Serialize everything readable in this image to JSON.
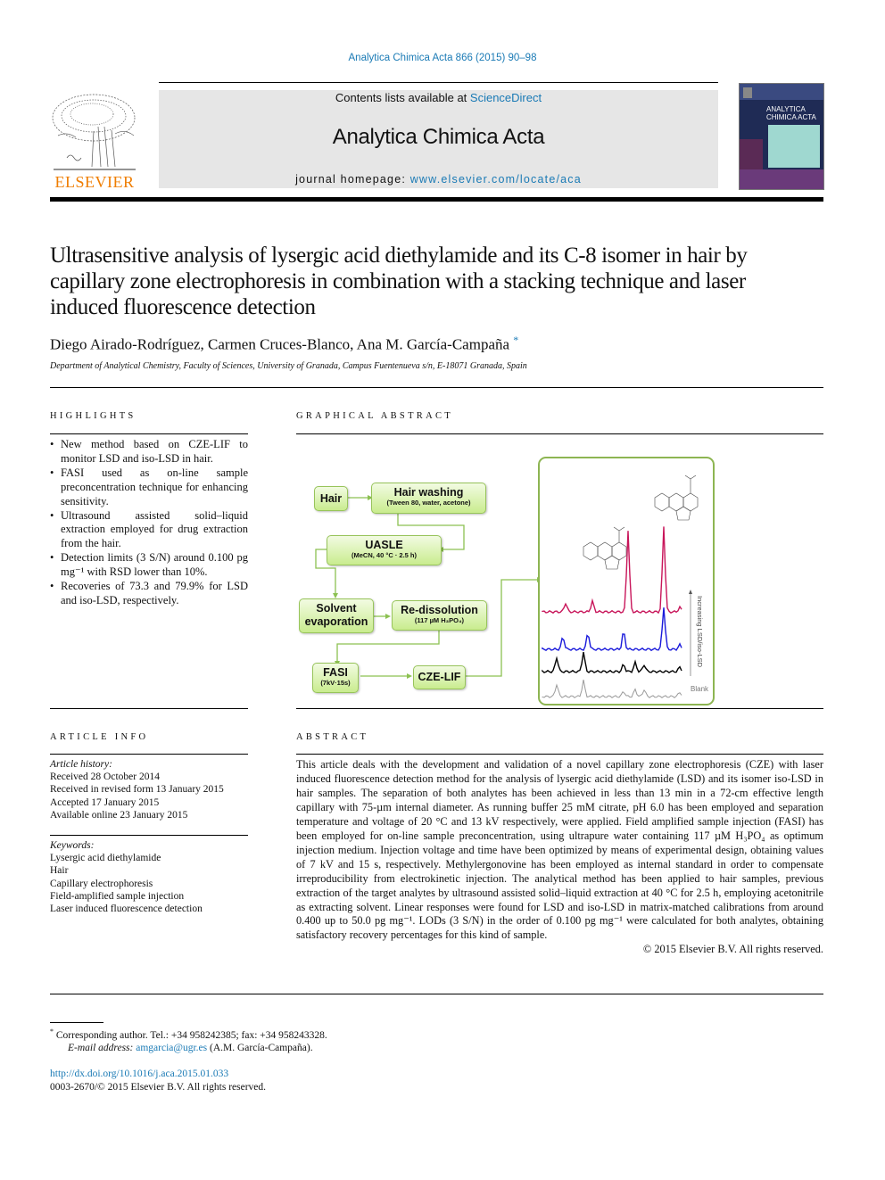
{
  "header": {
    "citation": "Analytica Chimica Acta 866 (2015) 90–98",
    "publisher_logo_text": "ELSEVIER",
    "contents_prefix": "Contents lists available at ",
    "contents_link": "ScienceDirect",
    "journal_title": "Analytica Chimica Acta",
    "homepage_prefix": "journal homepage: ",
    "homepage_link": "www.elsevier.com/locate/aca",
    "cover_title_line1": "ANALYTICA",
    "cover_title_line2": "CHIMICA ACTA"
  },
  "article": {
    "title": "Ultrasensitive analysis of lysergic acid diethylamide and its C-8 isomer in hair by capillary zone electrophoresis in combination with a stacking technique and laser induced fluorescence detection",
    "authors": "Diego Airado-Rodríguez, Carmen Cruces-Blanco, Ana M. García-Campaña",
    "corresponding_mark": "*",
    "affiliation": "Department of Analytical Chemistry, Faculty of Sciences, University of Granada, Campus Fuentenueva s/n, E-18071 Granada, Spain"
  },
  "highlights": {
    "heading": "HIGHLIGHTS",
    "items": [
      "New method based on CZE-LIF to monitor LSD and iso-LSD in hair.",
      "FASI used as on-line sample preconcentration technique for enhancing sensitivity.",
      "Ultrasound assisted solid–liquid extraction employed for drug extraction from the hair.",
      "Detection limits (3 S/N) around 0.100 pg mg⁻¹ with RSD lower than 10%.",
      "Recoveries of 73.3 and 79.9% for LSD and iso-LSD, respectively."
    ]
  },
  "graphical_abstract": {
    "heading": "GRAPHICAL ABSTRACT",
    "flow": {
      "hair": "Hair",
      "washing": "Hair washing",
      "washing_sub": "(Tween 80, water, acetone)",
      "uasle": "UASLE",
      "uasle_sub": "(MeCN, 40 °C · 2.5 h)",
      "solvent1": "Solvent",
      "solvent2": "evaporation",
      "redissolution": "Re-dissolution",
      "redissolution_sub": "(117 µM H₃PO₄)",
      "fasi": "FASI",
      "fasi_sub": "(7kV·15s)",
      "czelif": "CZE-LIF"
    },
    "electropherogram": {
      "axis_label": "Increasing LSD/iso-LSD",
      "blank_label": "Blank",
      "trace_colors": [
        "#c8155a",
        "#1a1adb",
        "#000000",
        "#9a9a9a"
      ]
    }
  },
  "article_info": {
    "heading": "ARTICLE INFO",
    "history_label": "Article history:",
    "history": [
      "Received 28 October 2014",
      "Received in revised form 13 January 2015",
      "Accepted 17 January 2015",
      "Available online 23 January 2015"
    ],
    "keywords_label": "Keywords:",
    "keywords": [
      "Lysergic acid diethylamide",
      "Hair",
      "Capillary electrophoresis",
      "Field-amplified sample injection",
      "Laser induced fluorescence detection"
    ]
  },
  "abstract": {
    "heading": "ABSTRACT",
    "text": "This article deals with the development and validation of a novel capillary zone electrophoresis (CZE) with laser induced fluorescence detection method for the analysis of lysergic acid diethylamide (LSD) and its isomer iso-LSD in hair samples. The separation of both analytes has been achieved in less than 13 min in a 72-cm effective length capillary with 75-µm internal diameter. As running buffer 25 mM citrate, pH 6.0 has been employed and separation temperature and voltage of 20 °C and 13 kV respectively, were applied. Field amplified sample injection (FASI) has been employed for on-line sample preconcentration, using ultrapure water containing 117 µM H₃PO₄ as optimum injection medium. Injection voltage and time have been optimized by means of experimental design, obtaining values of 7 kV and 15 s, respectively. Methylergonovine has been employed as internal standard in order to compensate irreproducibility from electrokinetic injection. The analytical method has been applied to hair samples, previous extraction of the target analytes by ultrasound assisted solid–liquid extraction at 40 °C for 2.5 h, employing acetonitrile as extracting solvent. Linear responses were found for LSD and iso-LSD in matrix-matched calibrations from around 0.400 up to 50.0 pg mg⁻¹. LODs (3 S/N) in the order of 0.100 pg mg⁻¹ were calculated for both analytes, obtaining satisfactory recovery percentages for this kind of sample.",
    "copyright": "© 2015 Elsevier B.V. All rights reserved."
  },
  "footnote": {
    "mark": "*",
    "corresponding": "Corresponding author. Tel.: +34 958242385; fax: +34 958243328.",
    "email_label": "E-mail address: ",
    "email": "amgarcia@ugr.es",
    "email_suffix": " (A.M. García-Campaña).",
    "doi": "http://dx.doi.org/10.1016/j.aca.2015.01.033",
    "issn": "0003-2670/© 2015 Elsevier B.V. All rights reserved."
  }
}
